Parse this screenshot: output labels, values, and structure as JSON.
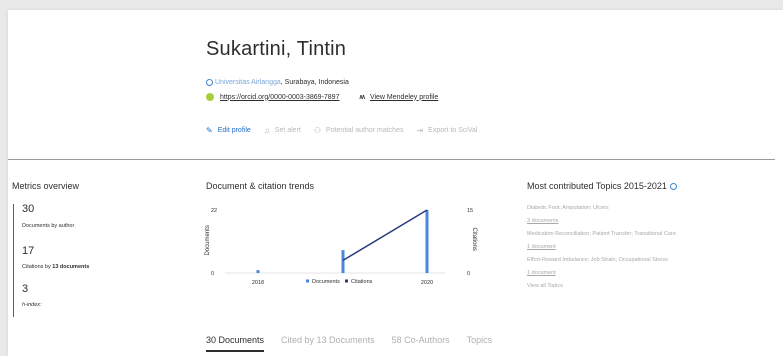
{
  "author": {
    "name": "Sukartini, Tintin",
    "institution": "Universitas Airlangga",
    "location": ", Surabaya, Indonesia",
    "orcid_url": "https://orcid.org/0000-0003-3869-7897",
    "mendeley_link": "View Mendeley profile"
  },
  "actions": [
    {
      "label": "Edit profile",
      "icon": "pencil-icon"
    },
    {
      "label": "Set alert",
      "icon": "bell-icon"
    },
    {
      "label": "Potential author matches",
      "icon": "people-icon"
    },
    {
      "label": "Export to SciVal",
      "icon": "export-icon"
    }
  ],
  "metrics": {
    "title": "Metrics overview",
    "documents": "30",
    "documents_label": "Documents by author",
    "citations": "17",
    "citations_label_prefix": "Citations by ",
    "citations_label_bold": "13 documents",
    "hindex": "3",
    "hindex_label": "h-index:"
  },
  "trends": {
    "title": "Document & citation trends"
  },
  "chart_data": {
    "type": "bar",
    "x": [
      "2018",
      "2019",
      "2020"
    ],
    "series": [
      {
        "name": "Documents",
        "type": "bar",
        "color": "#4a86d9",
        "values": [
          1,
          8,
          22
        ]
      },
      {
        "name": "Citations",
        "type": "line",
        "color": "#2b3a7a",
        "values": [
          0,
          3,
          15
        ]
      }
    ],
    "xticks": [
      "2018",
      "2020"
    ],
    "y_left": {
      "label": "Documents",
      "ticks": [
        "22",
        "11",
        "0"
      ],
      "range": [
        0,
        22
      ]
    },
    "y_right": {
      "label": "Citations",
      "ticks": [
        "15",
        "7",
        "0"
      ],
      "range": [
        0,
        15
      ]
    },
    "legend": "bottom"
  },
  "topics": {
    "title": "Most contributed Topics 2015-2021",
    "items": [
      {
        "name": "Diabetic Foot; Amputation; Ulcers",
        "docs": "3 documents"
      },
      {
        "name": "Medication Reconciliation; Patient Transfer; Transitional Care",
        "docs": "1 document"
      },
      {
        "name": "Effort-Reward Imbalance; Job Strain; Occupational Stress",
        "docs": "1 document"
      }
    ],
    "view_all": "View all Topics"
  },
  "tabs": [
    {
      "label": "30 Documents",
      "active": true
    },
    {
      "label": "Cited by 13 Documents",
      "active": false
    },
    {
      "label": "58 Co-Authors",
      "active": false
    },
    {
      "label": "Topics",
      "active": false
    }
  ]
}
